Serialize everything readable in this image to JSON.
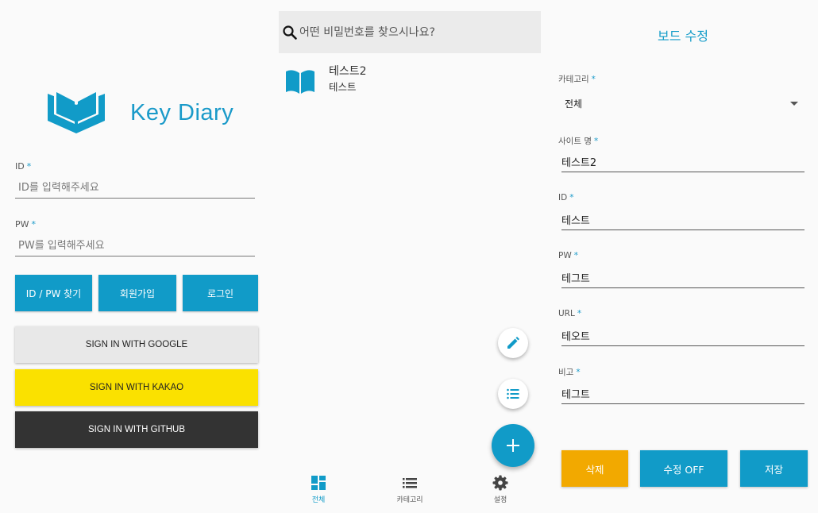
{
  "login": {
    "app_title": "Key Diary",
    "id_label": "ID",
    "id_placeholder": "ID를 입력해주세요",
    "pw_label": "PW",
    "pw_placeholder": "PW를 입력해주세요",
    "required_mark": "*",
    "buttons": {
      "find": "ID / PW 찾기",
      "signup": "회원가입",
      "login": "로그인"
    },
    "social": {
      "google": "SIGN IN WITH GOOGLE",
      "kakao": "SIGN IN WITH KAKAO",
      "github": "SIGN IN WITH GITHUB"
    }
  },
  "list": {
    "search_placeholder": "어떤 비밀번호를 찾으시나요?",
    "items": [
      {
        "title": "테스트2",
        "subtitle": "테스트"
      }
    ],
    "nav": [
      {
        "label": "전체",
        "icon": "dashboard-icon",
        "active": true
      },
      {
        "label": "카테고리",
        "icon": "list-icon",
        "active": false
      },
      {
        "label": "설정",
        "icon": "gear-icon",
        "active": false
      }
    ]
  },
  "edit": {
    "title": "보드 수정",
    "required_mark": "*",
    "category_label": "카테고리",
    "category_value": "전체",
    "site_label": "사이트 명",
    "site_value": "테스트2",
    "id_label": "ID",
    "id_value": "테스트",
    "pw_label": "PW",
    "pw_value": "테그트",
    "url_label": "URL",
    "url_value": "테오트",
    "note_label": "비고",
    "note_value": "테그트",
    "buttons": {
      "delete": "삭제",
      "edit_toggle": "수정 OFF",
      "save": "저장"
    }
  },
  "colors": {
    "accent": "#119bc8",
    "kakao": "#fae100",
    "github": "#333333",
    "google": "#e8e8e8",
    "delete": "#f2a900"
  }
}
